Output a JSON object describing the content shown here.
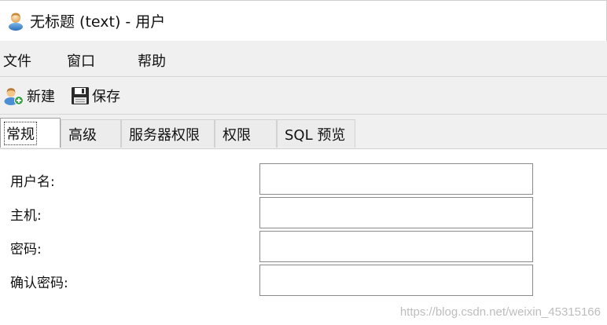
{
  "window": {
    "title": "无标题 (text) - 用户",
    "icon": "user-icon"
  },
  "menu": {
    "items": [
      "文件",
      "窗口",
      "帮助"
    ]
  },
  "toolbar": {
    "new_label": "新建",
    "save_label": "保存"
  },
  "tabs": [
    {
      "label": "常规",
      "active": true
    },
    {
      "label": "高级",
      "active": false
    },
    {
      "label": "服务器权限",
      "active": false
    },
    {
      "label": "权限",
      "active": false
    },
    {
      "label": "SQL 预览",
      "active": false
    }
  ],
  "form": {
    "fields": [
      {
        "label": "用户名:",
        "value": ""
      },
      {
        "label": "主机:",
        "value": ""
      },
      {
        "label": "密码:",
        "value": ""
      },
      {
        "label": "确认密码:",
        "value": ""
      }
    ]
  },
  "watermark": "https://blog.csdn.net/weixin_45315166",
  "colors": {
    "background": "#ffffff",
    "bar": "#f0f0f0",
    "input_border": "#8a8a8a"
  }
}
